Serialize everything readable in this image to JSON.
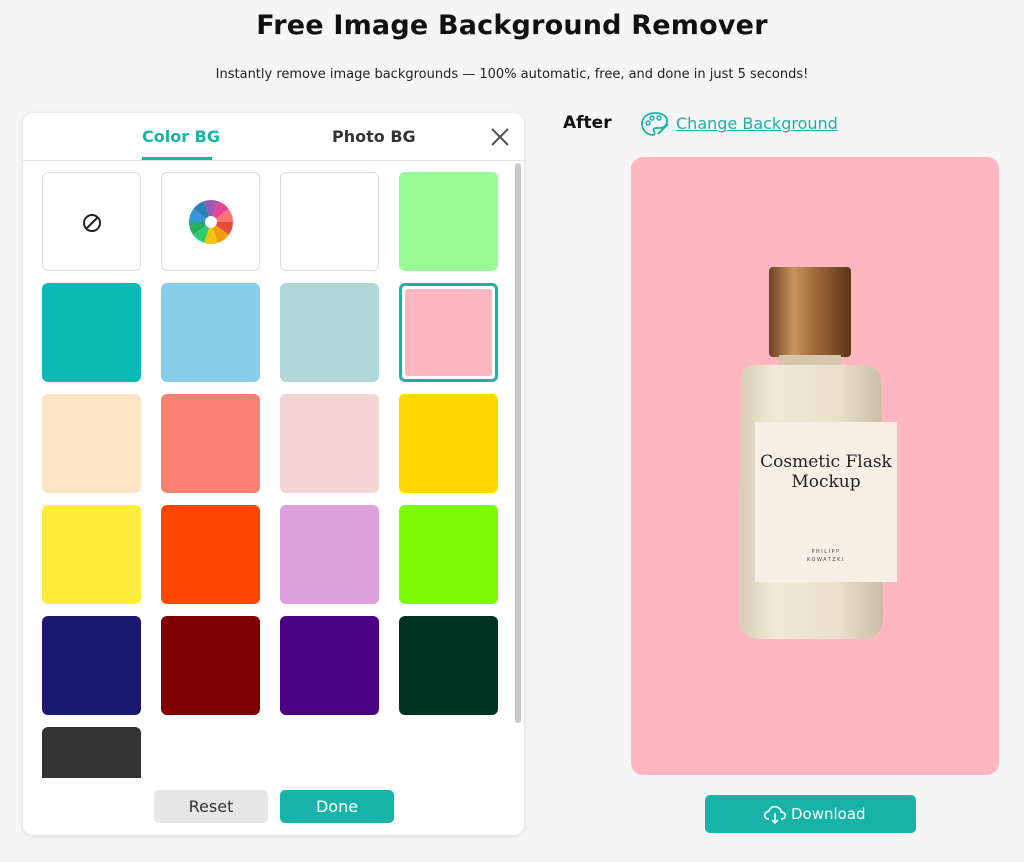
{
  "header": {
    "title": "Free Image Background Remover",
    "subtitle": "Instantly remove image backgrounds — 100% automatic, free, and done in just 5 seconds!"
  },
  "panel": {
    "tabs": [
      {
        "label": "Color BG",
        "active": true
      },
      {
        "label": "Photo BG",
        "active": false
      }
    ],
    "close_icon": "close-icon",
    "swatches": [
      {
        "type": "none",
        "icon": "no-color-icon"
      },
      {
        "type": "picker",
        "icon": "color-wheel-icon"
      },
      {
        "color": "#ffffff"
      },
      {
        "color": "#98fb98"
      },
      {
        "color": "#0abab5"
      },
      {
        "color": "#87ceeb"
      },
      {
        "color": "#b0d8d8"
      },
      {
        "color": "#ffb6c1",
        "selected": true
      },
      {
        "color": "#ffe4c4"
      },
      {
        "color": "#fa8072"
      },
      {
        "color": "#f4d3d3"
      },
      {
        "color": "#ffd700"
      },
      {
        "color": "#ffeb3b"
      },
      {
        "color": "#ff4500"
      },
      {
        "color": "#dda0dd"
      },
      {
        "color": "#7cfc00"
      },
      {
        "color": "#191970"
      },
      {
        "color": "#800000"
      },
      {
        "color": "#4b0082"
      },
      {
        "color": "#003322"
      },
      {
        "color": "#333333"
      }
    ],
    "reset_label": "Reset",
    "done_label": "Done"
  },
  "result": {
    "after_label": "After",
    "change_bg_label": "Change Background",
    "change_bg_icon": "palette-icon",
    "preview_bg": "#ffb6c1",
    "bottle_label_line1": "Cosmetic Flask",
    "bottle_label_line2": "Mockup",
    "bottle_brand_line1": "PHILIPP",
    "bottle_brand_line2": "KOWATZKI",
    "download_label": "Download",
    "download_icon": "cloud-download-icon"
  },
  "colors": {
    "accent": "#17b3a9"
  }
}
